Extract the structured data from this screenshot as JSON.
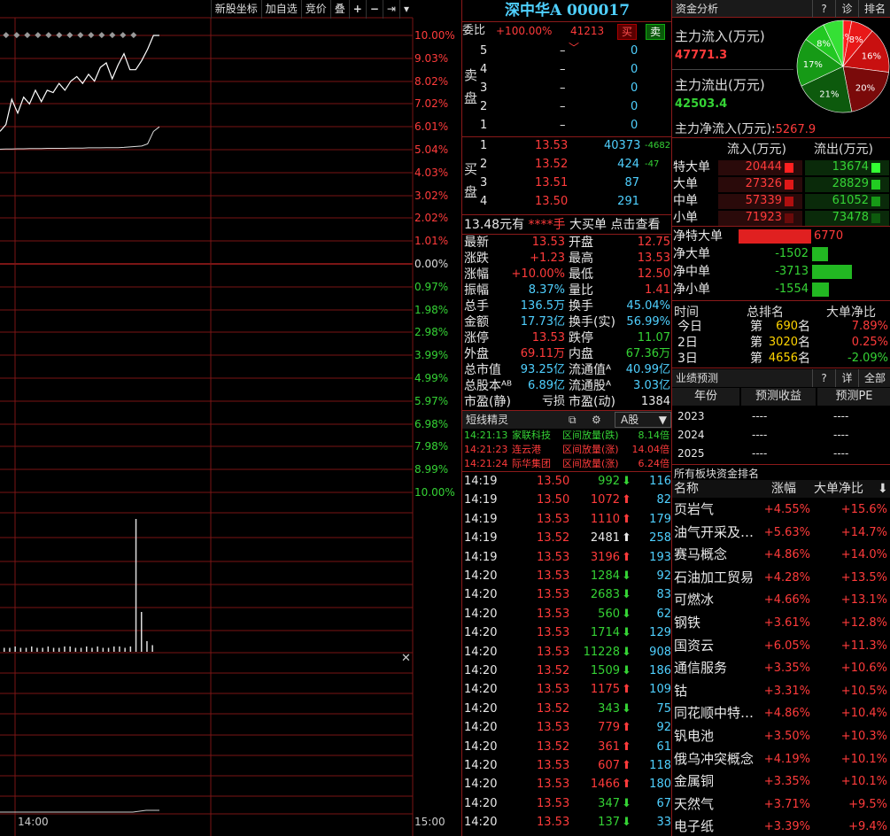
{
  "toolbar": {
    "items": [
      "新股坐标",
      "加自选",
      "竞价",
      "叠"
    ],
    "icons": [
      "plus-icon",
      "minus-icon",
      "next-icon",
      "dropdown-icon"
    ]
  },
  "chart": {
    "pct_up": [
      "10.00%",
      "9.03%",
      "8.02%",
      "7.02%",
      "6.01%",
      "5.04%",
      "4.03%",
      "3.02%",
      "2.02%",
      "1.01%"
    ],
    "pct_zero": "0.00%",
    "pct_down": [
      "0.97%",
      "1.98%",
      "2.98%",
      "3.99%",
      "4.99%",
      "5.97%",
      "6.98%",
      "7.98%",
      "8.99%",
      "10.00%"
    ],
    "time_start": "14:00",
    "time_end": "15:00",
    "price_line": [
      5.8,
      6.1,
      7.2,
      6.6,
      7.3,
      7.0,
      7.6,
      7.1,
      7.6,
      7.5,
      7.9,
      7.6,
      8.0,
      8.2,
      7.9,
      8.3,
      8.0,
      8.6,
      8.8,
      8.1,
      8.7,
      9.2,
      8.5,
      8.5,
      8.9,
      9.4,
      10.0,
      10.0
    ],
    "avg_line": [
      5.02,
      5.03,
      5.03,
      5.04,
      5.04,
      5.05,
      5.05,
      5.05,
      5.06,
      5.06,
      5.06,
      5.06,
      5.07,
      5.07,
      5.07,
      5.08,
      5.08,
      5.08,
      5.09,
      5.09,
      5.09,
      5.1,
      5.12,
      5.14,
      5.16,
      5.25,
      5.8,
      6.0
    ],
    "volume_bars": [
      3,
      3,
      4,
      3,
      3,
      4,
      3,
      3,
      4,
      3,
      3,
      4,
      4,
      3,
      3,
      4,
      3,
      4,
      3,
      3,
      4,
      4,
      3,
      4,
      100,
      30,
      8,
      5
    ]
  },
  "stock": {
    "title": "深中华A 000017"
  },
  "order": {
    "weibi_label": "委比",
    "weibi": "+100.00%",
    "weicha": "41213",
    "buy": "买",
    "sell": "卖",
    "sell_label": [
      "卖",
      "盘"
    ],
    "buy_label": [
      "买",
      "盘"
    ],
    "sells": [
      {
        "lv": "5",
        "p": "–",
        "v": "0"
      },
      {
        "lv": "4",
        "p": "–",
        "v": "0"
      },
      {
        "lv": "3",
        "p": "–",
        "v": "0"
      },
      {
        "lv": "2",
        "p": "–",
        "v": "0"
      },
      {
        "lv": "1",
        "p": "–",
        "v": "0"
      }
    ],
    "buys": [
      {
        "lv": "1",
        "p": "13.53",
        "v": "40373",
        "d": "-4682"
      },
      {
        "lv": "2",
        "p": "13.52",
        "v": "424",
        "d": "-47"
      },
      {
        "lv": "3",
        "p": "13.51",
        "v": "87",
        "d": ""
      },
      {
        "lv": "4",
        "p": "13.50",
        "v": "291",
        "d": ""
      }
    ],
    "bigorder": {
      "a": "13.48元有",
      "b": "****手",
      "c": "大买单",
      "d": "点击查看"
    }
  },
  "quote": [
    {
      "l1": "最新",
      "v1": "13.53",
      "c1": "red",
      "l2": "开盘",
      "v2": "12.75",
      "c2": "red"
    },
    {
      "l1": "涨跌",
      "v1": "+1.23",
      "c1": "red",
      "l2": "最高",
      "v2": "13.53",
      "c2": "red"
    },
    {
      "l1": "涨幅",
      "v1": "+10.00%",
      "c1": "red",
      "l2": "最低",
      "v2": "12.50",
      "c2": "red"
    },
    {
      "l1": "振幅",
      "v1": "8.37%",
      "c1": "cyan",
      "l2": "量比",
      "v2": "1.41",
      "c2": "red"
    },
    {
      "l1": "总手",
      "v1": "136.5万",
      "c1": "cyan",
      "l2": "换手",
      "v2": "45.04%",
      "c2": "cyan"
    },
    {
      "l1": "金额",
      "v1": "17.73亿",
      "c1": "cyan",
      "l2": "换手(实)",
      "v2": "56.99%",
      "c2": "cyan"
    },
    {
      "l1": "涨停",
      "v1": "13.53",
      "c1": "red",
      "l2": "跌停",
      "v2": "11.07",
      "c2": "grn"
    },
    {
      "l1": "外盘",
      "v1": "69.11万",
      "c1": "red",
      "l2": "内盘",
      "v2": "67.36万",
      "c2": "grn"
    },
    {
      "l1": "总市值",
      "v1": "93.25亿",
      "c1": "cyan",
      "l2": "流通值ᴬ",
      "v2": "40.99亿",
      "c2": "cyan"
    },
    {
      "l1": "总股本ᴬᴮ",
      "v1": "6.89亿",
      "c1": "cyan",
      "l2": "流通股ᴬ",
      "v2": "3.03亿",
      "c2": "cyan"
    },
    {
      "l1": "市盈(静)",
      "v1": "亏损",
      "c1": "wht",
      "l2": "市盈(动)",
      "v2": "1384",
      "c2": "wht"
    }
  ],
  "shortline": {
    "title": "短线精灵",
    "market": "A股",
    "items": [
      {
        "t": "14:21:13",
        "n": "家联科技",
        "e": "区间放量(跌)",
        "v": "8.14倍",
        "c": "grn"
      },
      {
        "t": "14:21:23",
        "n": "连云港",
        "e": "区间放量(涨)",
        "v": "14.04倍",
        "c": "red"
      },
      {
        "t": "14:21:24",
        "n": "际华集团",
        "e": "区间放量(涨)",
        "v": "6.24倍",
        "c": "red"
      }
    ]
  },
  "ticks": [
    {
      "t": "14:19",
      "p": "13.50",
      "v": "992",
      "dir": "down",
      "n": "116",
      "c": "grn"
    },
    {
      "t": "14:19",
      "p": "13.50",
      "v": "1072",
      "dir": "up",
      "n": "82",
      "c": "red"
    },
    {
      "t": "14:19",
      "p": "13.53",
      "v": "1110",
      "dir": "up",
      "n": "179",
      "c": "red"
    },
    {
      "t": "14:19",
      "p": "13.52",
      "v": "2481",
      "dir": "up",
      "n": "258",
      "c": "wht"
    },
    {
      "t": "14:19",
      "p": "13.53",
      "v": "3196",
      "dir": "up",
      "n": "193",
      "c": "red"
    },
    {
      "t": "14:20",
      "p": "13.53",
      "v": "1284",
      "dir": "down",
      "n": "92",
      "c": "grn"
    },
    {
      "t": "14:20",
      "p": "13.53",
      "v": "2683",
      "dir": "down",
      "n": "83",
      "c": "grn"
    },
    {
      "t": "14:20",
      "p": "13.53",
      "v": "560",
      "dir": "down",
      "n": "62",
      "c": "grn"
    },
    {
      "t": "14:20",
      "p": "13.53",
      "v": "1714",
      "dir": "down",
      "n": "129",
      "c": "grn"
    },
    {
      "t": "14:20",
      "p": "13.53",
      "v": "11228",
      "dir": "down",
      "n": "908",
      "c": "grn"
    },
    {
      "t": "14:20",
      "p": "13.52",
      "v": "1509",
      "dir": "down",
      "n": "186",
      "c": "grn"
    },
    {
      "t": "14:20",
      "p": "13.53",
      "v": "1175",
      "dir": "up",
      "n": "109",
      "c": "red"
    },
    {
      "t": "14:20",
      "p": "13.52",
      "v": "343",
      "dir": "down",
      "n": "75",
      "c": "grn"
    },
    {
      "t": "14:20",
      "p": "13.53",
      "v": "779",
      "dir": "up",
      "n": "92",
      "c": "red"
    },
    {
      "t": "14:20",
      "p": "13.52",
      "v": "361",
      "dir": "up",
      "n": "61",
      "c": "red"
    },
    {
      "t": "14:20",
      "p": "13.53",
      "v": "607",
      "dir": "up",
      "n": "118",
      "c": "red"
    },
    {
      "t": "14:20",
      "p": "13.53",
      "v": "1466",
      "dir": "up",
      "n": "180",
      "c": "red"
    },
    {
      "t": "14:20",
      "p": "13.53",
      "v": "347",
      "dir": "down",
      "n": "67",
      "c": "grn"
    },
    {
      "t": "14:20",
      "p": "13.53",
      "v": "137",
      "dir": "down",
      "n": "33",
      "c": "grn"
    }
  ],
  "fund": {
    "title": "资金分析",
    "btns": [
      "?",
      "诊",
      "排名"
    ],
    "in_label": "主力流入(万元)",
    "in_val": "47771.3",
    "out_label": "主力流出(万元)",
    "out_val": "42503.4",
    "net_label": "主力净流入(万元):",
    "net_val": "5267.9",
    "pie": [
      {
        "label": "3%",
        "value": 3,
        "color": "#ff1f1f"
      },
      {
        "label": "8%",
        "value": 8,
        "color": "#e81818"
      },
      {
        "label": "16%",
        "value": 16,
        "color": "#c81010"
      },
      {
        "label": "20%",
        "value": 20,
        "color": "#7a0a0a"
      },
      {
        "label": "21%",
        "value": 21,
        "color": "#0d5a0d"
      },
      {
        "label": "17%",
        "value": 17,
        "color": "#169a16"
      },
      {
        "label": "8%",
        "value": 8,
        "color": "#22c822"
      },
      {
        "label": "",
        "value": 7,
        "color": "#35e035"
      }
    ],
    "col_in": "流入(万元)",
    "col_out": "流出(万元)",
    "rows": [
      {
        "n": "特大单",
        "i": "20444",
        "o": "13674"
      },
      {
        "n": "大单",
        "i": "27326",
        "o": "28829"
      },
      {
        "n": "中单",
        "i": "57339",
        "o": "61052"
      },
      {
        "n": "小单",
        "i": "71923",
        "o": "73478"
      }
    ],
    "net": [
      {
        "n": "净特大单",
        "v": "6770",
        "c": "red",
        "val": 6770
      },
      {
        "n": "净大单",
        "v": "-1502",
        "c": "grn",
        "val": -1502
      },
      {
        "n": "净中单",
        "v": "-3713",
        "c": "grn",
        "val": -3713
      },
      {
        "n": "净小单",
        "v": "-1554",
        "c": "grn",
        "val": -1554
      }
    ],
    "rank_h": [
      "时间",
      "总排名",
      "大单净比"
    ],
    "rank": [
      {
        "t": "今日",
        "r1": "第",
        "r2": "690",
        "r3": "名",
        "v": "7.89%"
      },
      {
        "t": "2日",
        "r1": "第",
        "r2": "3020",
        "r3": "名",
        "v": "0.25%"
      },
      {
        "t": "3日",
        "r1": "第",
        "r2": "4656",
        "r3": "名",
        "v": "-2.09%"
      }
    ]
  },
  "forecast": {
    "title": "业绩预测",
    "btns": [
      "?",
      "详",
      "全部"
    ],
    "h": [
      "年份",
      "预测收益",
      "预测PE"
    ],
    "rows": [
      {
        "y": "2023",
        "a": "----",
        "b": "----"
      },
      {
        "y": "2024",
        "a": "----",
        "b": "----"
      },
      {
        "y": "2025",
        "a": "----",
        "b": "----"
      }
    ]
  },
  "sector": {
    "title": "所有板块资金排名",
    "h": [
      "名称",
      "涨幅",
      "大单净比"
    ],
    "rows": [
      {
        "n": "页岩气",
        "p": "+4.55%",
        "v": "+15.6%"
      },
      {
        "n": "油气开采及…",
        "p": "+5.63%",
        "v": "+14.7%"
      },
      {
        "n": "赛马概念",
        "p": "+4.86%",
        "v": "+14.0%"
      },
      {
        "n": "石油加工贸易",
        "p": "+4.28%",
        "v": "+13.5%"
      },
      {
        "n": "可燃冰",
        "p": "+4.66%",
        "v": "+13.1%"
      },
      {
        "n": "钢铁",
        "p": "+3.61%",
        "v": "+12.8%"
      },
      {
        "n": "国资云",
        "p": "+6.05%",
        "v": "+11.3%"
      },
      {
        "n": "通信服务",
        "p": "+3.35%",
        "v": "+10.6%"
      },
      {
        "n": "钴",
        "p": "+3.31%",
        "v": "+10.5%"
      },
      {
        "n": "同花顺中特…",
        "p": "+4.86%",
        "v": "+10.4%"
      },
      {
        "n": "钒电池",
        "p": "+3.50%",
        "v": "+10.3%"
      },
      {
        "n": "俄乌冲突概念",
        "p": "+4.19%",
        "v": "+10.1%"
      },
      {
        "n": "金属铜",
        "p": "+3.35%",
        "v": "+10.1%"
      },
      {
        "n": "天然气",
        "p": "+3.71%",
        "v": "+9.5%"
      },
      {
        "n": "电子纸",
        "p": "+3.39%",
        "v": "+9.4%"
      }
    ]
  }
}
